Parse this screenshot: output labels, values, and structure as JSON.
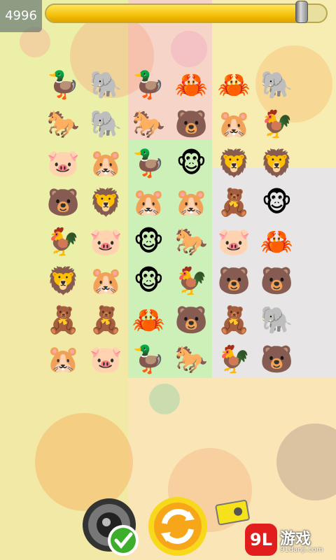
{
  "score": "4996",
  "timer": {
    "fraction": 0.92
  },
  "board": {
    "rows": [
      [
        "duck",
        "elephant",
        "duck",
        "crab",
        "crab",
        "elephant"
      ],
      [
        "horse",
        "elephant",
        "horse",
        "bear",
        "hamster",
        "rooster"
      ],
      [
        "pig",
        "hamster",
        "duck",
        "monkey",
        "lion",
        "lion"
      ],
      [
        "bear",
        "lion",
        "hamster",
        "hamster",
        "teddy",
        "monkey"
      ],
      [
        "rooster",
        "pig",
        "monkey",
        "horse",
        "pig",
        "crab"
      ],
      [
        "lion",
        "hamster",
        "monkey",
        "rooster",
        "bear",
        "bear"
      ],
      [
        "teddy",
        "teddy",
        "crab",
        "bear",
        "teddy",
        "elephant"
      ],
      [
        "hamster",
        "pig",
        "duck",
        "horse",
        "rooster",
        "bear"
      ]
    ],
    "glyphs": {
      "duck": "🦆",
      "elephant": "🐘",
      "crab": "🦀",
      "horse": "🐎",
      "bear": "🐻",
      "hamster": "🐹",
      "rooster": "🐓",
      "pig": "🐷",
      "monkey": "🐵",
      "lion": "🦁",
      "teddy": "🧸"
    }
  },
  "controls": {
    "sound_icon": "speaker-icon",
    "refresh_icon": "refresh-icon",
    "hint_icon": "hint-icon"
  },
  "watermark": {
    "logo": "9L",
    "text": "游戏",
    "sub": "91danji.com"
  },
  "colors": {
    "timer": "#f5c10b",
    "watermark": "#e11d1d"
  }
}
